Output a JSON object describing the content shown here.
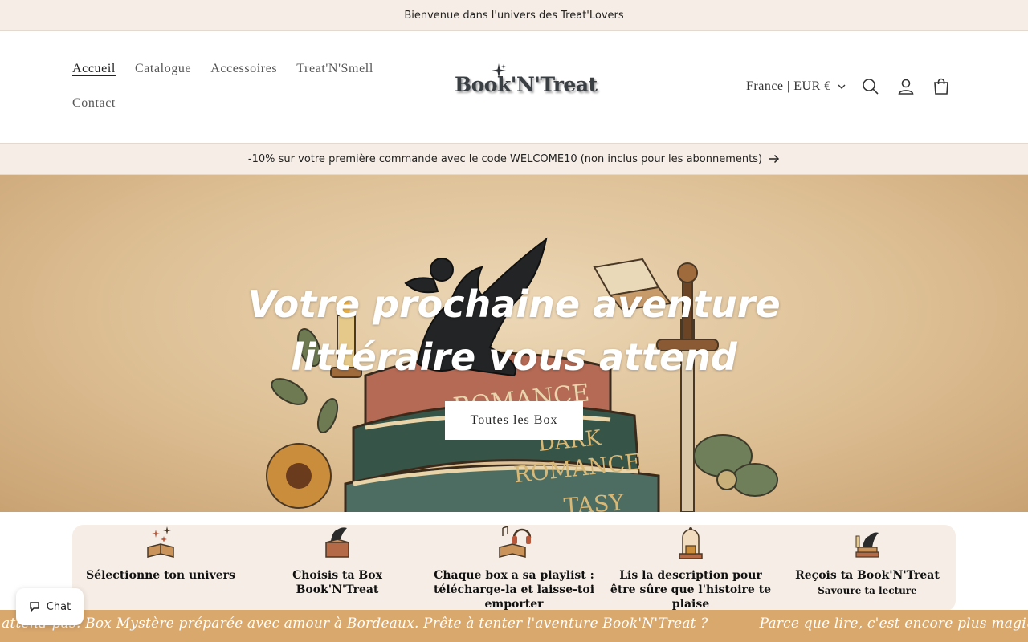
{
  "announcement": "Bienvenue dans l'univers des Treat'Lovers",
  "nav": {
    "items": [
      "Accueil",
      "Catalogue",
      "Accessoires",
      "Treat'N'Smell",
      "Contact"
    ],
    "active": "Accueil"
  },
  "logo": "Book'N'Treat",
  "header": {
    "country_currency": "France | EUR €",
    "icons": [
      "search-icon",
      "account-icon",
      "cart-icon"
    ]
  },
  "promo": "-10% sur votre première commande avec le code WELCOME10 (non inclus pour les abonnements)",
  "hero": {
    "title": "Votre prochaine aventure littéraire vous attend",
    "button": "Toutes les Box",
    "book_spines": [
      "ROMANCE",
      "DARK ROMANCE",
      "FANTASY"
    ]
  },
  "steps": [
    {
      "title": "Sélectionne ton univers",
      "sub": "",
      "icon": "open-book-sparkles-icon"
    },
    {
      "title": "Choisis ta Box Book'N'Treat",
      "sub": "",
      "icon": "dragon-box-icon"
    },
    {
      "title": "Chaque box a sa playlist : télécharge-la et laisse-toi emporter",
      "sub": "",
      "icon": "book-headphones-icon"
    },
    {
      "title": "Lis la description pour être sûre que l'histoire te plaise",
      "sub": "",
      "icon": "book-bell-jar-icon"
    },
    {
      "title": "Reçois ta Book'N'Treat",
      "sub": "Savoure ta lecture",
      "icon": "dragon-books-icon"
    }
  ],
  "marquee": [
    "Parce que lire, c'est encore plus magique quand on ne s'y attend pas. Box Mystère préparée avec amour à Bordeaux. Prête à tenter l'aventure Book'N'Treat ?",
    "Parce que lire, c'est encore plus magique quand on ne s'y attend pas. Box Mystère préparée avec amour à Bordeaux. Prête à tenter l'aventure Book'N'Treat ?"
  ],
  "chat": "Chat",
  "colors": {
    "cream": "#f6eee6",
    "marquee_bg": "#d9a86d",
    "hero_bg": "#ddbf94"
  }
}
